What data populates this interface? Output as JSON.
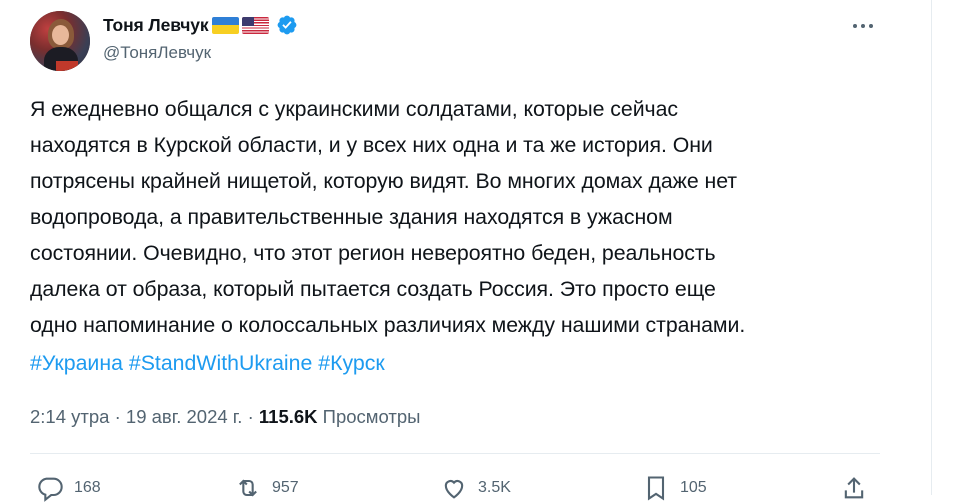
{
  "author": {
    "display_name": "Тоня Левчук",
    "handle": "@ТоняЛевчук",
    "flags": [
      "ukraine-flag",
      "usa-flag"
    ],
    "verified": true
  },
  "tweet": {
    "lines": [
      "Я ежедневно общался с украинскими солдатами, которые сейчас",
      "находятся в Курской области, и у всех них одна и та же история. Они",
      "потрясены крайней нищетой, которую видят. Во многих домах даже нет",
      "водопровода, а правительственные здания находятся в ужасном",
      "состоянии. Очевидно, что этот регион невероятно беден, реальность",
      "далека от образа, который пытается создать Россия. Это просто еще",
      "одно напоминание о колоссальных различиях между нашими странами."
    ],
    "hashtags": [
      "#Украина",
      "#StandWithUkraine",
      "#Курск"
    ]
  },
  "meta": {
    "time": "2:14 утра",
    "sep1": " · ",
    "date": "19 авг. 2024 г.",
    "sep2": " · ",
    "views_count": "115.6K",
    "views_label": "Просмотры"
  },
  "actions": {
    "replies": "168",
    "reposts": "957",
    "likes": "3.5K",
    "bookmarks": "105"
  },
  "colors": {
    "accent": "#1d9bf0",
    "text": "#0f1419",
    "muted": "#536471"
  }
}
